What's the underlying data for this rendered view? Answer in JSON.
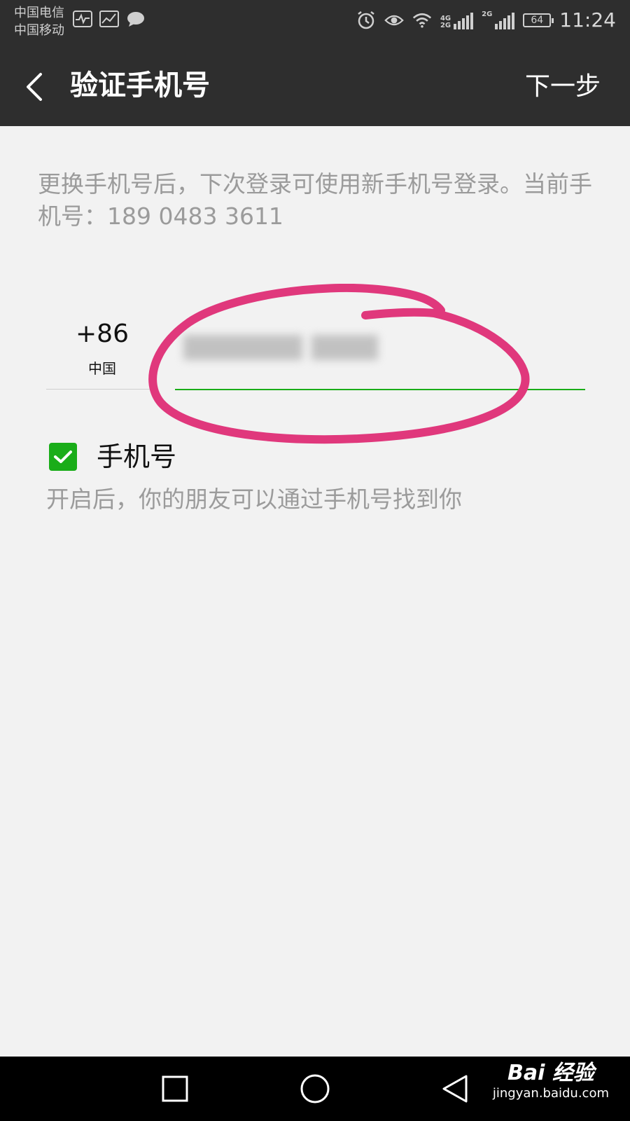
{
  "status_bar": {
    "carrier_1": "中国电信",
    "carrier_2": "中国移动",
    "network_1": "4G",
    "network_2": "2G",
    "network_3": "2G",
    "battery": "64",
    "time": "11:24"
  },
  "app_bar": {
    "title": "验证手机号",
    "next_label": "下一步"
  },
  "description": "更换手机号后，下次登录可使用新手机号登录。当前手机号：189 0483 3611",
  "country": {
    "code": "+86",
    "name": "中国"
  },
  "phone_input": {
    "value": ""
  },
  "checkbox": {
    "label": "手机号",
    "checked": true,
    "description": "开启后，你的朋友可以通过手机号找到你"
  },
  "watermark": {
    "main": "Bai 经验",
    "sub": "jingyan.baidu.com"
  },
  "colors": {
    "accent": "#1aad19",
    "bar": "#2e2e2e",
    "annotation": "#e0387c"
  }
}
